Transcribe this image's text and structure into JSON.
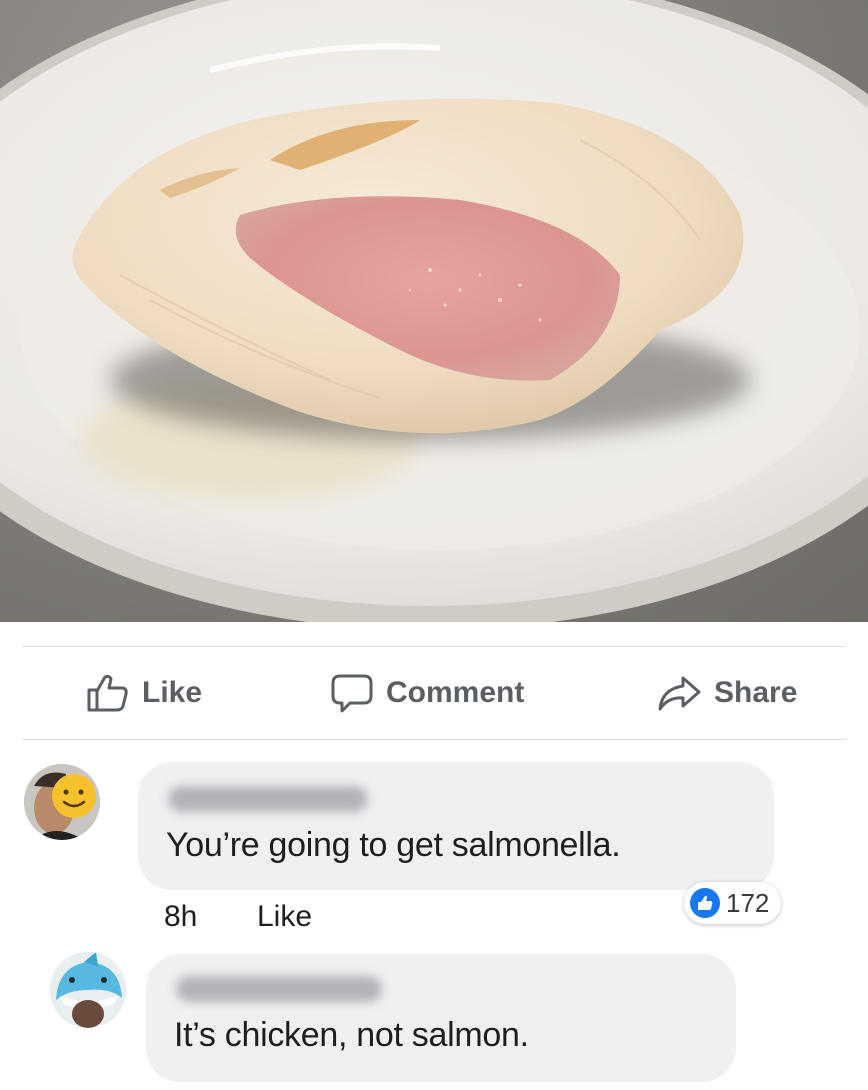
{
  "post": {
    "photo_alt": "",
    "actions": {
      "like_label": "Like",
      "comment_label": "Comment",
      "share_label": "Share"
    }
  },
  "comments": [
    {
      "text": "You’re going to get salmonella.",
      "time": "8h",
      "like_label": "Like",
      "reaction_count": "172",
      "avatar_icon": "smiley-face-icon"
    },
    {
      "text": "It’s chicken, not salmon.",
      "avatar_icon": "shark-hat-avatar"
    }
  ],
  "colors": {
    "accent": "#1877f2",
    "bubble": "#eff0f2",
    "action_text": "#5b5e63"
  }
}
